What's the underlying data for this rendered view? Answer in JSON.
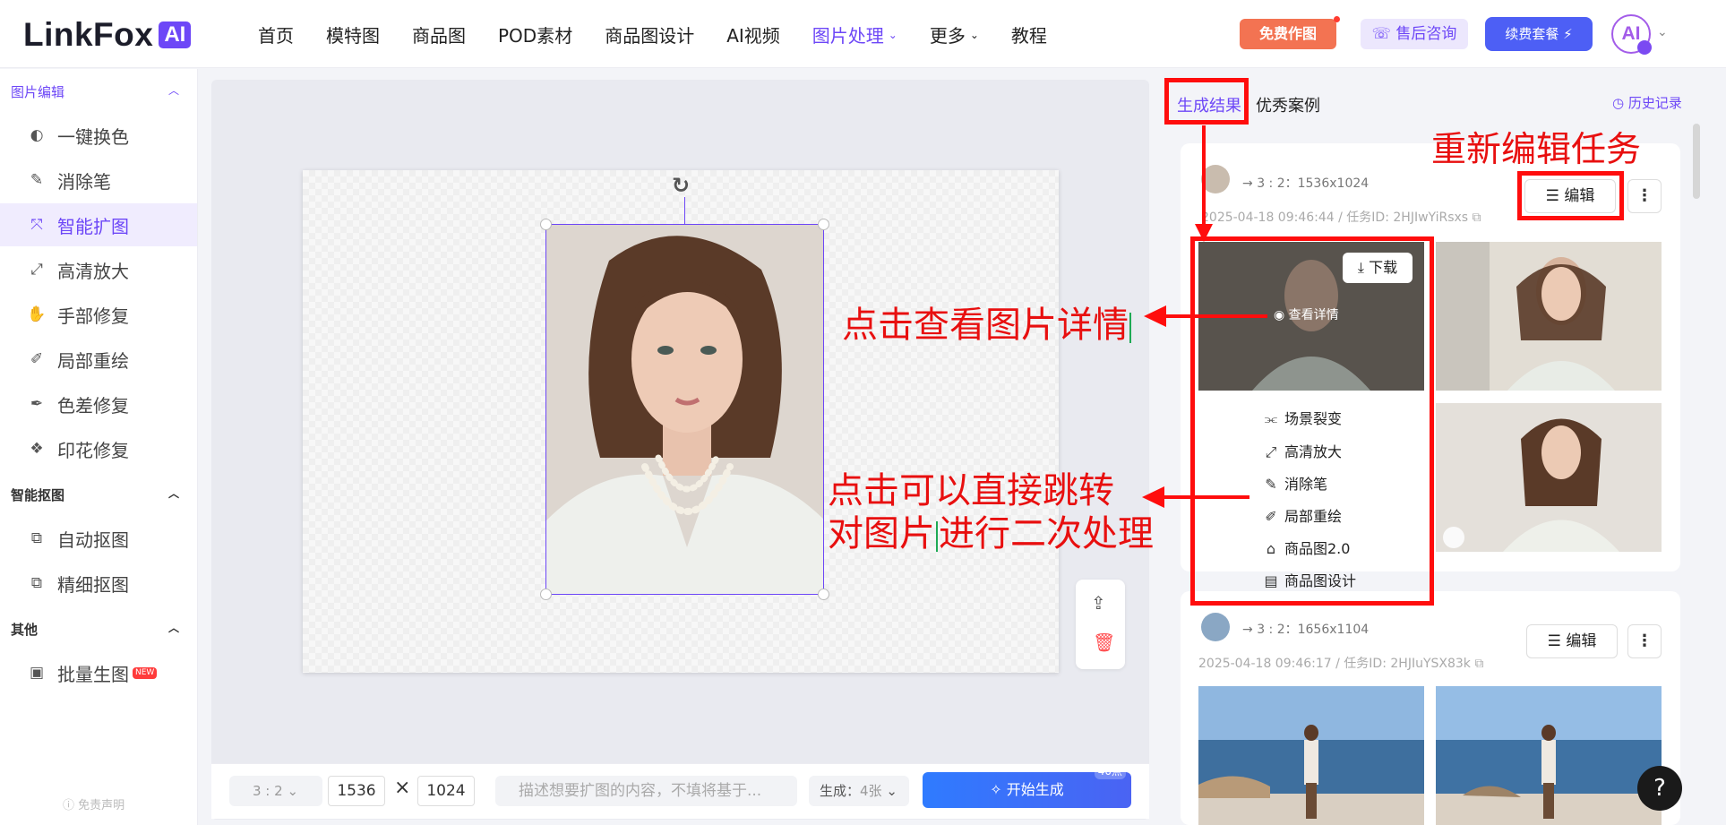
{
  "brand": {
    "name": "LinkFox",
    "badge": "AI"
  },
  "nav": {
    "items": [
      "首页",
      "模特图",
      "商品图",
      "POD素材",
      "商品图设计",
      "AI视频",
      "图片处理",
      "更多",
      "教程"
    ],
    "active": "图片处理"
  },
  "header": {
    "free_btn": "免费作图",
    "consult_btn": "售后咨询",
    "renew_btn": "续费套餐 ⚡",
    "avatar_text": "AI"
  },
  "sidebar": {
    "sections": [
      {
        "title": "图片编辑",
        "items": [
          "一键换色",
          "消除笔",
          "智能扩图",
          "高清放大",
          "手部修复",
          "局部重绘",
          "色差修复",
          "印花修复"
        ]
      },
      {
        "title": "智能抠图",
        "items": [
          "自动抠图",
          "精细抠图"
        ]
      },
      {
        "title": "其他",
        "items": [
          "批量生图"
        ]
      }
    ],
    "active": "智能扩图",
    "new_badge": "NEW",
    "disclaimer": "ⓘ 免责声明"
  },
  "toolbar": {
    "ratio": "3 : 2",
    "width": "1536",
    "height": "1024",
    "prompt_placeholder": "描述想要扩图的内容，不填将基于...",
    "count_label": "生成：",
    "count_value": "4张",
    "start_label": "开始生成",
    "points": "40点"
  },
  "right_panel": {
    "tabs": [
      "生成结果",
      "优秀案例"
    ],
    "history": "历史记录",
    "tasks": [
      {
        "ratio": "3 : 2：1536x1024",
        "date": "2025-04-18 09:46:44 / 任务ID: 2HJIwYiRsxs",
        "edit": "编辑"
      },
      {
        "ratio": "3 : 2：1656x1104",
        "date": "2025-04-18 09:46:17 / 任务ID: 2HJIuYSX83k",
        "edit": "编辑"
      }
    ],
    "download": "下载",
    "view_detail": "查看详情",
    "actions": [
      "场景裂变",
      "高清放大",
      "消除笔",
      "局部重绘",
      "商品图2.0",
      "商品图设计"
    ]
  },
  "annotations": {
    "re_edit": "重新编辑任务",
    "view_detail": "点击查看图片详情",
    "jump_line1": "点击可以直接跳转",
    "jump_line2_a": "对图片",
    "jump_line2_b": "进行二次处理"
  },
  "colors": {
    "brand": "#6d47f7",
    "annotation": "#ff0d0d",
    "start": "#3a6ff7"
  },
  "icons": {
    "help": "?"
  }
}
